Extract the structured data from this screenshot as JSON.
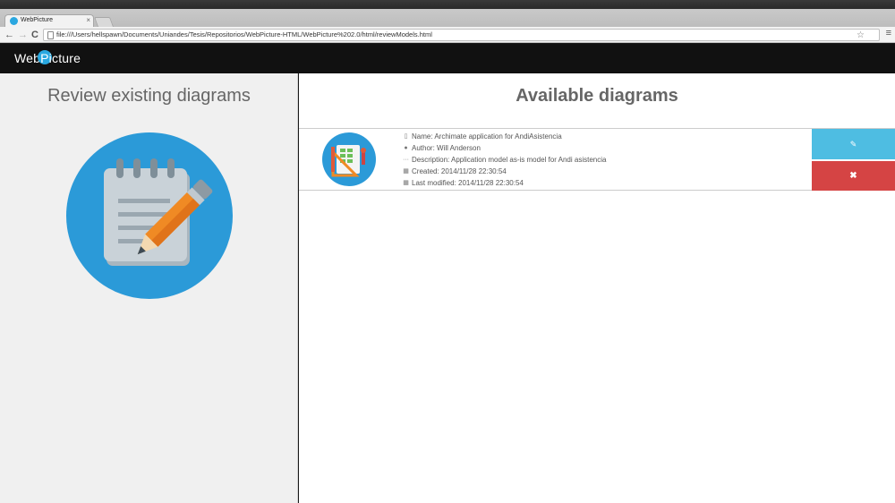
{
  "browser": {
    "tab_title": "WebPicture",
    "tab_close": "×",
    "url": "file:///Users/hellspawn/Documents/Uniandes/Tesis/Repositorios/WebPicture-HTML/WebPicture%202.0/html/reviewModels.html",
    "back_glyph": "←",
    "forward_glyph": "→",
    "reload_glyph": "C",
    "star_glyph": "☆",
    "menu_glyph": "≡"
  },
  "navbar": {
    "brand_pre": "Web",
    "brand_pi": "Pi",
    "brand_post": "cture",
    "brand_color": "#29a8e0"
  },
  "left": {
    "title": "Review existing diagrams",
    "illustration": "notepad-pencil-icon",
    "circle_color": "#2b9ad8"
  },
  "right": {
    "title": "Available diagrams",
    "diagrams": [
      {
        "name": "Name: Archimate application for AndiAsistencia",
        "author": "Author: Will Anderson",
        "description": "Description: Application model as-is model for Andi asistencia",
        "created": "Created: 2014/11/28 22:30:54",
        "modified": "Last modified: 2014/11/28 22:30:54",
        "edit_glyph": "✎",
        "delete_glyph": "✖"
      }
    ]
  },
  "colors": {
    "edit": "#4ebde2",
    "delete": "#d54444"
  }
}
